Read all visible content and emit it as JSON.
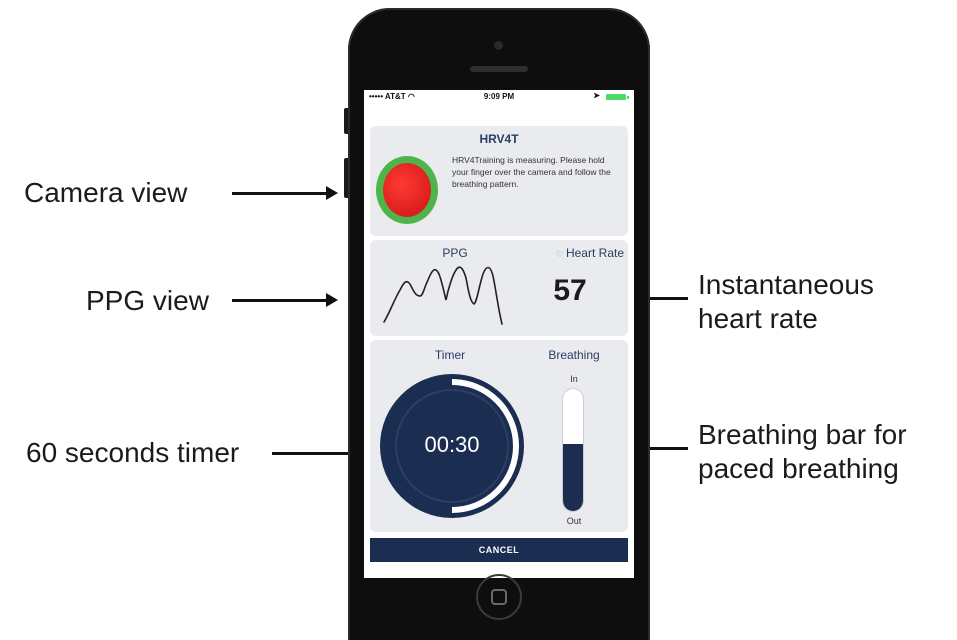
{
  "annotations": {
    "camera_view": "Camera view",
    "ppg_view": "PPG view",
    "timer": "60 seconds timer",
    "heart_rate_line1": "Instantaneous",
    "heart_rate_line2": "heart rate",
    "breathing_line1": "Breathing bar for",
    "breathing_line2": "paced breathing"
  },
  "status_bar": {
    "carrier": "••••• AT&T ◠",
    "time": "9:09 PM",
    "location": "➤"
  },
  "app": {
    "title": "HRV4T",
    "measuring_message": "HRV4Training is measuring. Please hold your finger over the camera and follow the breathing pattern.",
    "ppg_label": "PPG",
    "heart_rate_label": "Heart Rate",
    "heart_rate_value": "57",
    "timer_label": "Timer",
    "timer_value": "00:30",
    "timer_progress": 0.5,
    "breathing_label": "Breathing",
    "breathing_in": "In",
    "breathing_out": "Out",
    "breathing_level": 0.55,
    "cancel_label": "CANCEL"
  },
  "colors": {
    "navy": "#1c2d52",
    "camera_red": "#e02424",
    "camera_ring": "#4fb54b",
    "panel_bg": "#e9ebee",
    "label_blue": "#2a3d63"
  },
  "icons": [
    "heart-icon",
    "wifi-icon",
    "location-arrow-icon",
    "battery-icon"
  ]
}
